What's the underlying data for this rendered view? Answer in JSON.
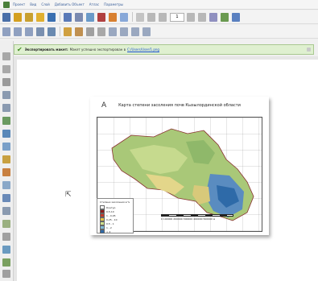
{
  "menubar": {
    "items": [
      "Проект",
      "Вид",
      "Слой",
      "Добавить Объект",
      "Атлас",
      "Параметры"
    ]
  },
  "toolbar": {
    "page_value": "1"
  },
  "message": {
    "title": "Экспортировать макет:",
    "text": "Макет успешно экспортирован в",
    "link": "C:/Users/User/1.png"
  },
  "map": {
    "title": "Карта степени засоления почв Кызылординской области",
    "north_letter": "A",
    "legend_title": "Степени засоления в %",
    "legend": [
      {
        "label": "Контур",
        "color": "#ffffff"
      },
      {
        "label": "0,5-10",
        "color": "#8b1a1a"
      },
      {
        "label": "1 - 0,05",
        "color": "#c0392b"
      },
      {
        "label": "0,25 - 10",
        "color": "#e6c34a"
      },
      {
        "label": "0,5 - 1",
        "color": "#cfe08a"
      },
      {
        "label": "1 - 2",
        "color": "#7fb9d6"
      },
      {
        "label": "> 2",
        "color": "#2e6aa8"
      }
    ],
    "scale_text": "0 100000 200000 300000 400000 500000 м"
  },
  "colors": {
    "accent_green": "#3f8a20",
    "message_bg": "#dff0d0",
    "link": "#1a4fd0"
  }
}
